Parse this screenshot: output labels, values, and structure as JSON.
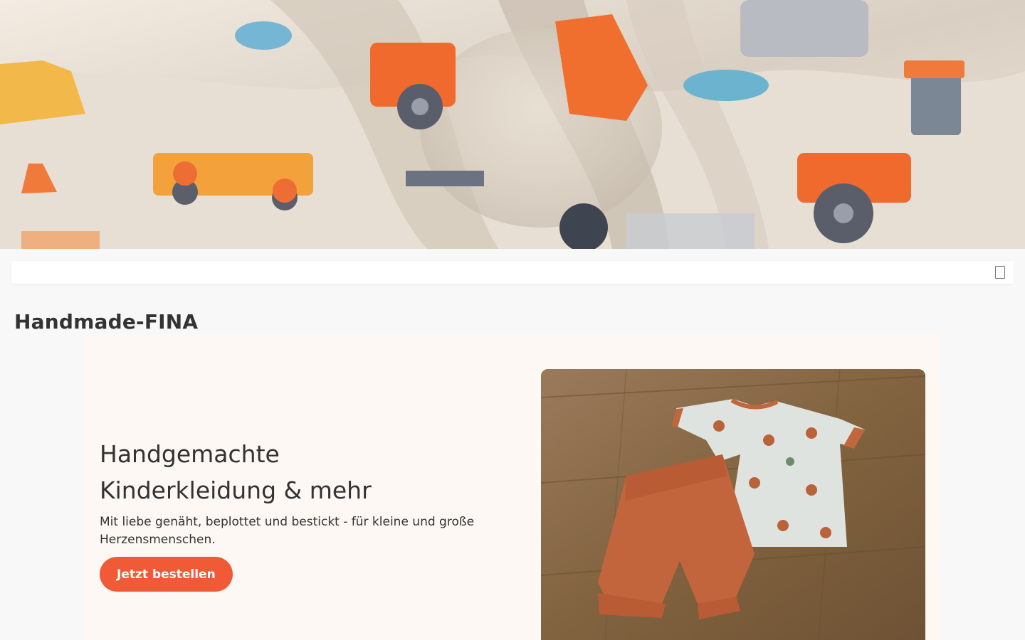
{
  "banner": {
    "image_alt": "fabric-with-tractor-and-vehicle-print"
  },
  "nav": {
    "toggle_icon": "menu-icon"
  },
  "site": {
    "title": "Handmade-FINA"
  },
  "hero": {
    "heading_line1": "Handgemachte",
    "heading_line2": "Kinderkleidung & mehr",
    "text": "Mit liebe genäht, beplottet und bestickt - für kleine und große Herzensmenschen.",
    "button_label": "Jetzt bestellen",
    "image_alt": "kids-shirt-and-shorts-on-wooden-floor"
  },
  "colors": {
    "accent": "#f15a36",
    "page_background": "#f8f8f8",
    "hero_background": "#fdf8f4",
    "text": "#333333"
  }
}
